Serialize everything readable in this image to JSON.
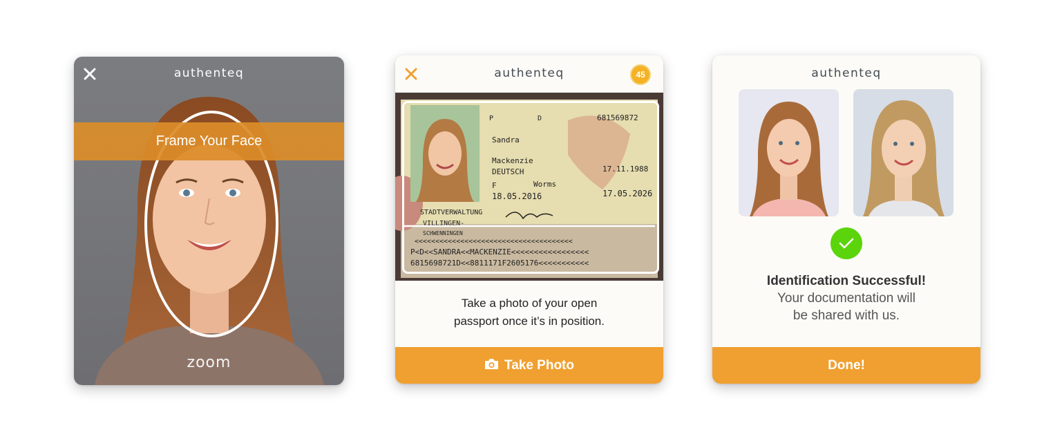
{
  "face_screen": {
    "brand": "authenteq",
    "close_icon": "close-icon",
    "banner": "Frame Your Face",
    "provider_logo": "zoom"
  },
  "passport_screen": {
    "brand": "authenteq",
    "close_icon": "close-icon",
    "timer": "45",
    "passport": {
      "type": "P",
      "code": "D",
      "number": "681569872",
      "surname": "Sandra",
      "given_names": "Mackenzie",
      "nationality": "DEUTSCH",
      "date_of_birth": "17.11.1988",
      "sex": "F",
      "place_of_birth": "Worms",
      "date_of_issue": "18.05.2016",
      "date_of_expiry": "17.05.2026",
      "authority_line1": "STADTVERWALTUNG",
      "authority_line2": "VILLINGEN-",
      "authority_line3": "SCHWENNINGEN",
      "mrz_line1": "<<<<<<<<<<<<<<<<<<<<<<<<<<<<<<<<<<<<<<",
      "mrz_line2": "P<D<<SANDRA<<MACKENZIE<<<<<<<<<<<<<<<<<",
      "mrz_line3": "6815698721D<<8811171F2605176<<<<<<<<<<<"
    },
    "instruction_line1": "Take a photo of your open",
    "instruction_line2": "passport once it’s in position.",
    "button_label": "Take Photo",
    "button_icon": "camera-icon"
  },
  "success_screen": {
    "brand": "authenteq",
    "status_icon": "checkmark-icon",
    "title": "Identification Successful!",
    "message_line1": "Your documentation will",
    "message_line2": "be shared with us.",
    "button_label": "Done!"
  },
  "colors": {
    "accent": "#f0a030",
    "banner": "#db8d2a",
    "success": "#5bd40c",
    "timer": "#f5b224"
  }
}
